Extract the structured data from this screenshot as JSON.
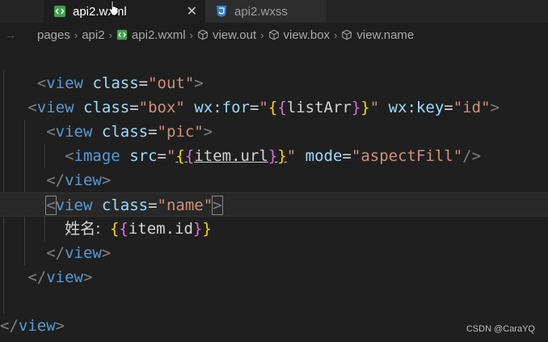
{
  "tabs": [
    {
      "label": "api2.wxml",
      "close": "✕",
      "icon": "wxml-file-icon"
    },
    {
      "label": "api2.wxss",
      "icon": "css-file-icon"
    }
  ],
  "breadcrumb": {
    "items": [
      "pages",
      "api2",
      "api2.wxml",
      "view.out",
      "view.box",
      "view.name"
    ]
  },
  "code": {
    "l1": {
      "t1": "view",
      "a1": "class",
      "v1": "\"out\""
    },
    "l3": {
      "t1": "view",
      "a1": "class",
      "v1": "\"box\"",
      "a2": "wx:for",
      "v2a": "\"",
      "v2b": "listArr",
      "v2c": "\"",
      "a3": "wx:key",
      "v3": "\"id\""
    },
    "l4": {
      "t1": "view",
      "a1": "class",
      "v1": "\"pic\""
    },
    "l5": {
      "t1": "image",
      "a1": "src",
      "v1a": "\"",
      "v1b": "item.url",
      "v1c": "\"",
      "a2": "mode",
      "v2": "\"aspectFill\""
    },
    "l6": {
      "t1": "view"
    },
    "l7": {
      "t1": "view",
      "a1": "class",
      "v1": "\"name\""
    },
    "l8": {
      "label": "姓名:",
      "expr": "item.id"
    },
    "l9": {
      "t1": "view"
    },
    "l10": {
      "t1": "view"
    },
    "l12": {
      "t1": "view"
    }
  },
  "watermark": "CSDN @CaraYQ",
  "colors": {
    "tag": "#569cd6",
    "attr": "#9cdcfe",
    "string": "#ce9178",
    "brace1": "#ffd700",
    "brace2": "#da70d6"
  }
}
